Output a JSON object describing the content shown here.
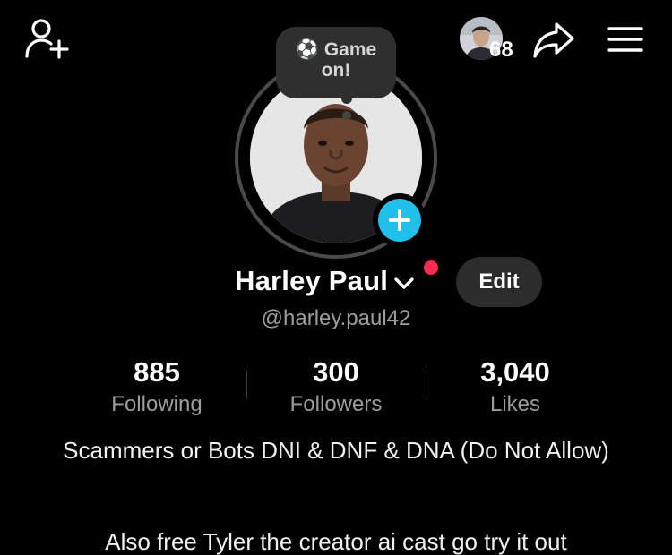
{
  "header": {
    "viewer_count": "68"
  },
  "status": {
    "emoji": "⚽",
    "line1": "Game",
    "line2": "on!"
  },
  "profile": {
    "name": "Harley Paul",
    "username": "@harley.paul42",
    "edit_label": "Edit"
  },
  "stats": [
    {
      "value": "885",
      "label": "Following"
    },
    {
      "value": "300",
      "label": "Followers"
    },
    {
      "value": "3,040",
      "label": "Likes"
    }
  ],
  "bio": {
    "line1": "Scammers or Bots DNI & DNF & DNA (Do Not Allow)",
    "line2": "Also free Tyler the creator ai cast go try it out"
  },
  "colors": {
    "background": "#000000",
    "add_story": "#20c0eb",
    "notification": "#fe2c55",
    "button_bg": "#2c2c2c",
    "secondary_text": "#9d9d9d"
  },
  "icons": {
    "top_left": "add-friend-icon",
    "share": "share-arrow-icon",
    "menu": "hamburger-menu-icon",
    "avatar_badge": "plus-icon",
    "name_dropdown": "chevron-down-icon"
  }
}
